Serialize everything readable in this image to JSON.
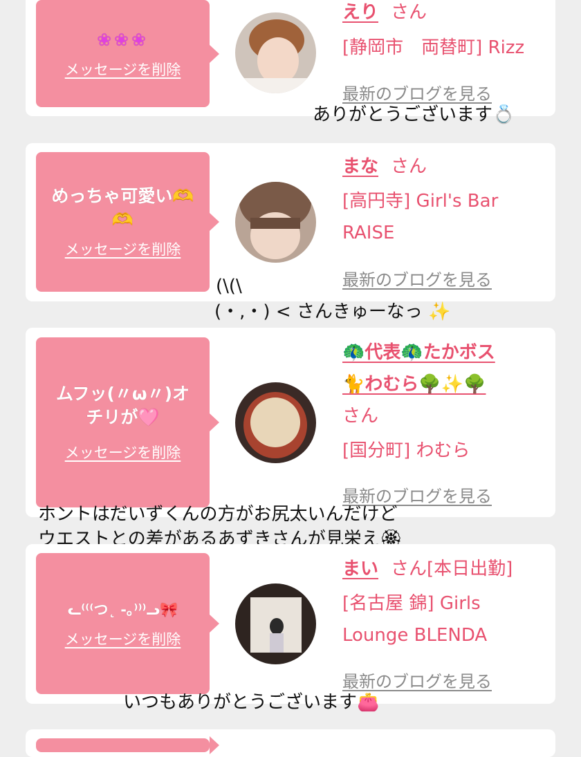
{
  "entries": [
    {
      "message": "❀❀❀",
      "delete_label": "メッセージを削除",
      "name": "えり",
      "san": "さん",
      "place": "[静岡市　両替町] Rizz",
      "blog_label": "最新のブログを見る"
    },
    {
      "message_line1": "めっちゃ可愛い🫶",
      "message_line2": "🫶",
      "delete_label": "メッセージを削除",
      "name": "まな",
      "san": "さん",
      "place_line1": "[高円寺] Girl's Bar",
      "place_line2": "RAISE",
      "blog_label": "最新のブログを見る"
    },
    {
      "message_line1": "ムフッ(〃ω〃)オ",
      "message_line2": "チリが🩷",
      "delete_label": "メッセージを削除",
      "name_line1": "🦚代表🦚たかボス",
      "name_line2": "🐈わむら🌳✨🌳",
      "san": "さん",
      "place": "[国分町] わむら",
      "blog_label": "最新のブログを見る"
    },
    {
      "message": "ᓚ⁽⁽⁽つ˛ -｡⁾⁾⁾ᓗ🎀",
      "delete_label": "メッセージを削除",
      "name": "まい",
      "san": "さん[本日出勤]",
      "place_line1": "[名古屋 錦] Girls",
      "place_line2": "Lounge BLENDA",
      "blog_label": "最新のブログを見る"
    }
  ],
  "overlays": {
    "text1": "ありがとうございます💍",
    "text2_line1": "(\\(\\",
    "text2_line2": "(・,・) < さんきゅーなっ ✨",
    "text3_line1": "ホントはだいずくんの方がお尻太いんだけど",
    "text3_line2": "ウエストとの差があるあずきさんが見栄え🏵",
    "text4": "いつもありがとうございます👛"
  },
  "colors": {
    "bubble": "#f48fa0",
    "link": "#e8516f",
    "blog": "#8a8a8a",
    "background": "#eeeeee"
  }
}
